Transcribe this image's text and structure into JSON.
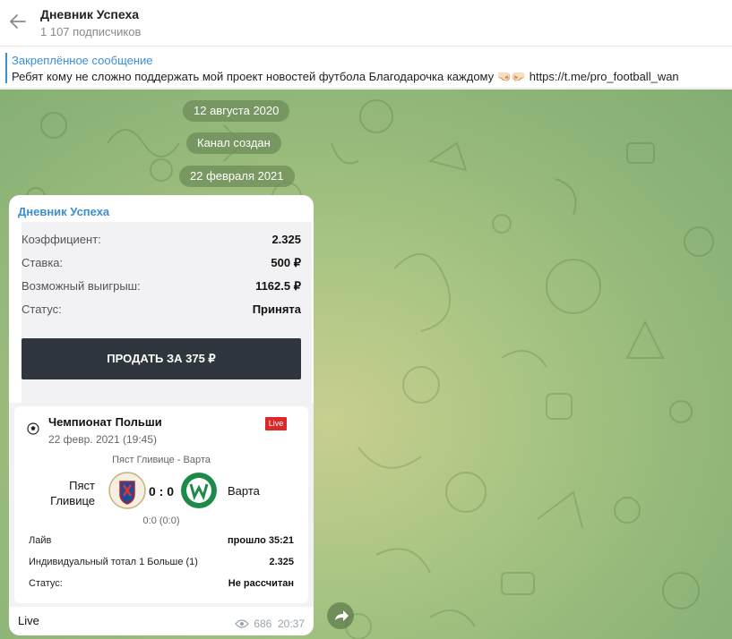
{
  "header": {
    "title": "Дневник Успеха",
    "subscribers": "1 107 подписчиков"
  },
  "pinned": {
    "title": "Закреплённое сообщение",
    "text": "Ребят кому не сложно поддержать мой проект новостей футбола Благодарочка каждому 🤜🏻🤛🏻  https://t.me/pro_football_wan"
  },
  "service": {
    "date1": "12 августа 2020",
    "created": "Канал создан",
    "date2": "22 февраля 2021"
  },
  "message": {
    "author": "Дневник Успеха",
    "bet": {
      "rows": [
        {
          "k": "Коэффициент:",
          "v": "2.325"
        },
        {
          "k": "Ставка:",
          "v": "500 ₽"
        },
        {
          "k": "Возможный выигрыш:",
          "v": "1162.5 ₽"
        },
        {
          "k": "Статус:",
          "v": "Принята"
        }
      ],
      "sell_label": "ПРОДАТЬ ЗА 375 ₽"
    },
    "event": {
      "league": "Чемпионат Польши",
      "date": "22 февр. 2021 (19:45)",
      "live_badge": "Live",
      "match": "Пяст Гливице - Варта",
      "team1": "Пяст Гливице",
      "score": "0 : 0",
      "team2": "Варта",
      "half_score": "0:0 (0:0)",
      "rows": [
        {
          "k": "Лайв",
          "v": "прошло 35:21"
        },
        {
          "k": "Индивидуальный тотал 1 Больше (1)",
          "v": "2.325"
        },
        {
          "k": "Статус:",
          "v": "Не рассчитан"
        }
      ]
    },
    "caption": "Live",
    "views": "686",
    "time": "20:37"
  },
  "colors": {
    "accent": "#3a8fd6",
    "live": "#d9292b",
    "sell_button": "#30363d"
  }
}
